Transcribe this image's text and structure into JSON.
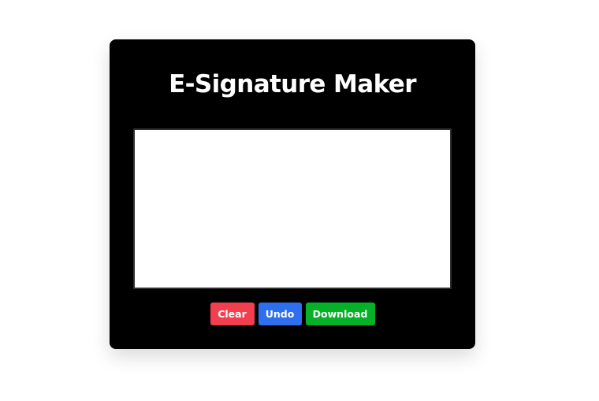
{
  "app": {
    "title": "E-Signature Maker"
  },
  "toolbar": {
    "clear_label": "Clear",
    "undo_label": "Undo",
    "download_label": "Download"
  },
  "colors": {
    "card_background": "#000000",
    "page_background": "#ffffff",
    "clear_button": "#f23f4f",
    "undo_button": "#2e6ff0",
    "download_button": "#05b227",
    "signature_pad": "#ffffff"
  }
}
